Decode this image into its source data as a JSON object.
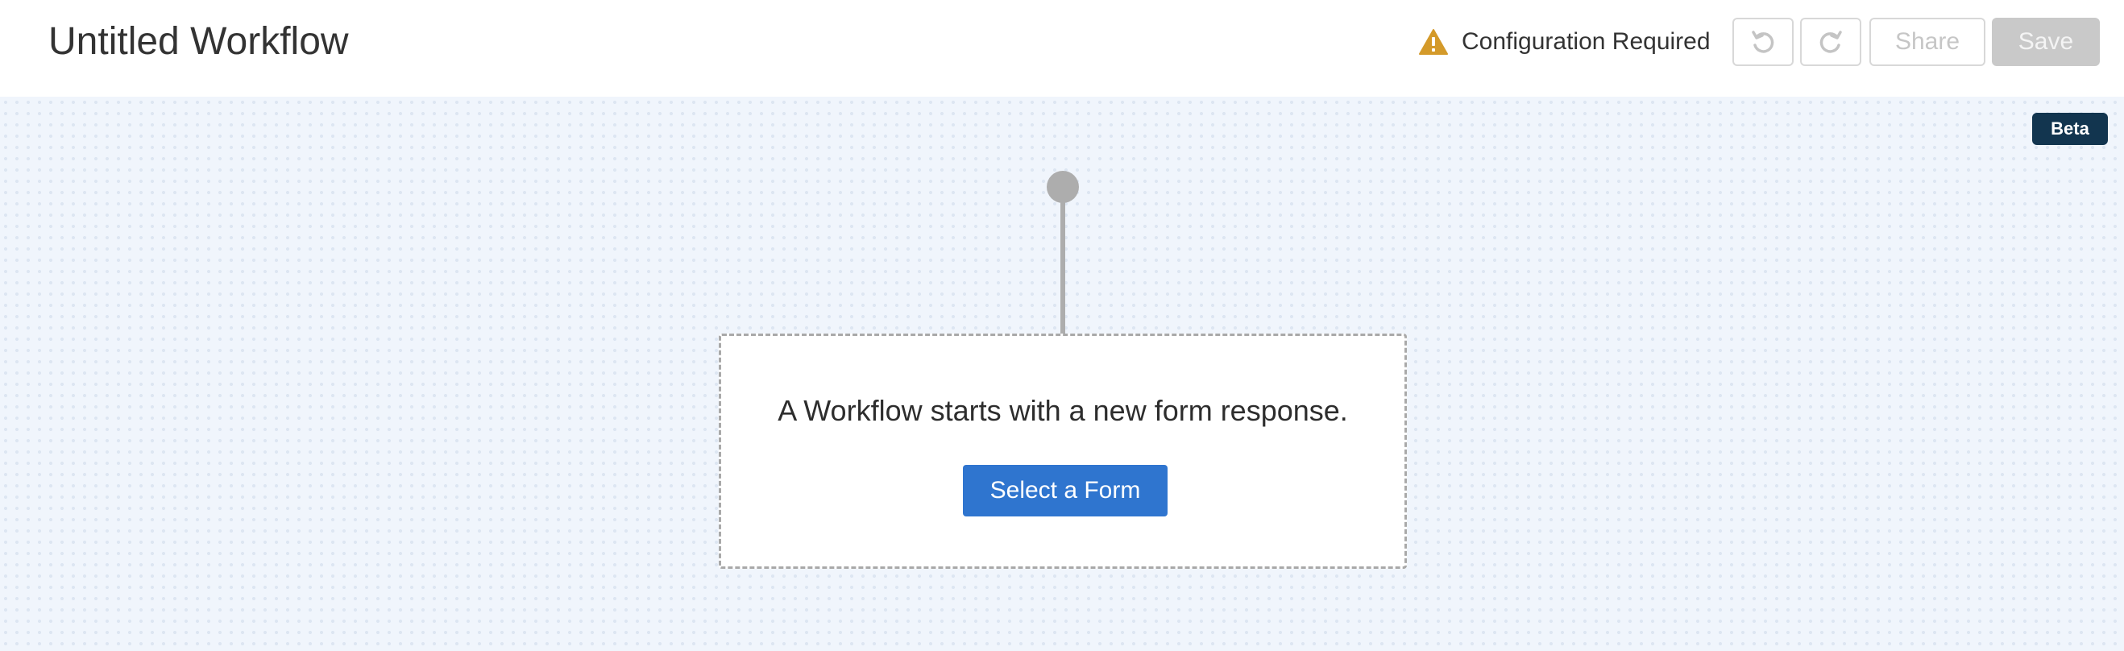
{
  "header": {
    "title": "Untitled Workflow",
    "status": {
      "text": "Configuration Required",
      "icon": "warning-triangle-icon",
      "icon_color": "#d49a2a"
    },
    "toolbar": {
      "undo_icon": "undo-icon",
      "redo_icon": "redo-icon",
      "share_label": "Share",
      "save_label": "Save"
    }
  },
  "canvas": {
    "badge": "Beta",
    "trigger_card": {
      "text": "A Workflow starts with a new form response.",
      "button_label": "Select a Form"
    }
  },
  "colors": {
    "primary": "#2f75cf",
    "badge_bg": "#12354f",
    "canvas_bg": "#f0f5fc",
    "disabled": "#c9c9c9"
  }
}
